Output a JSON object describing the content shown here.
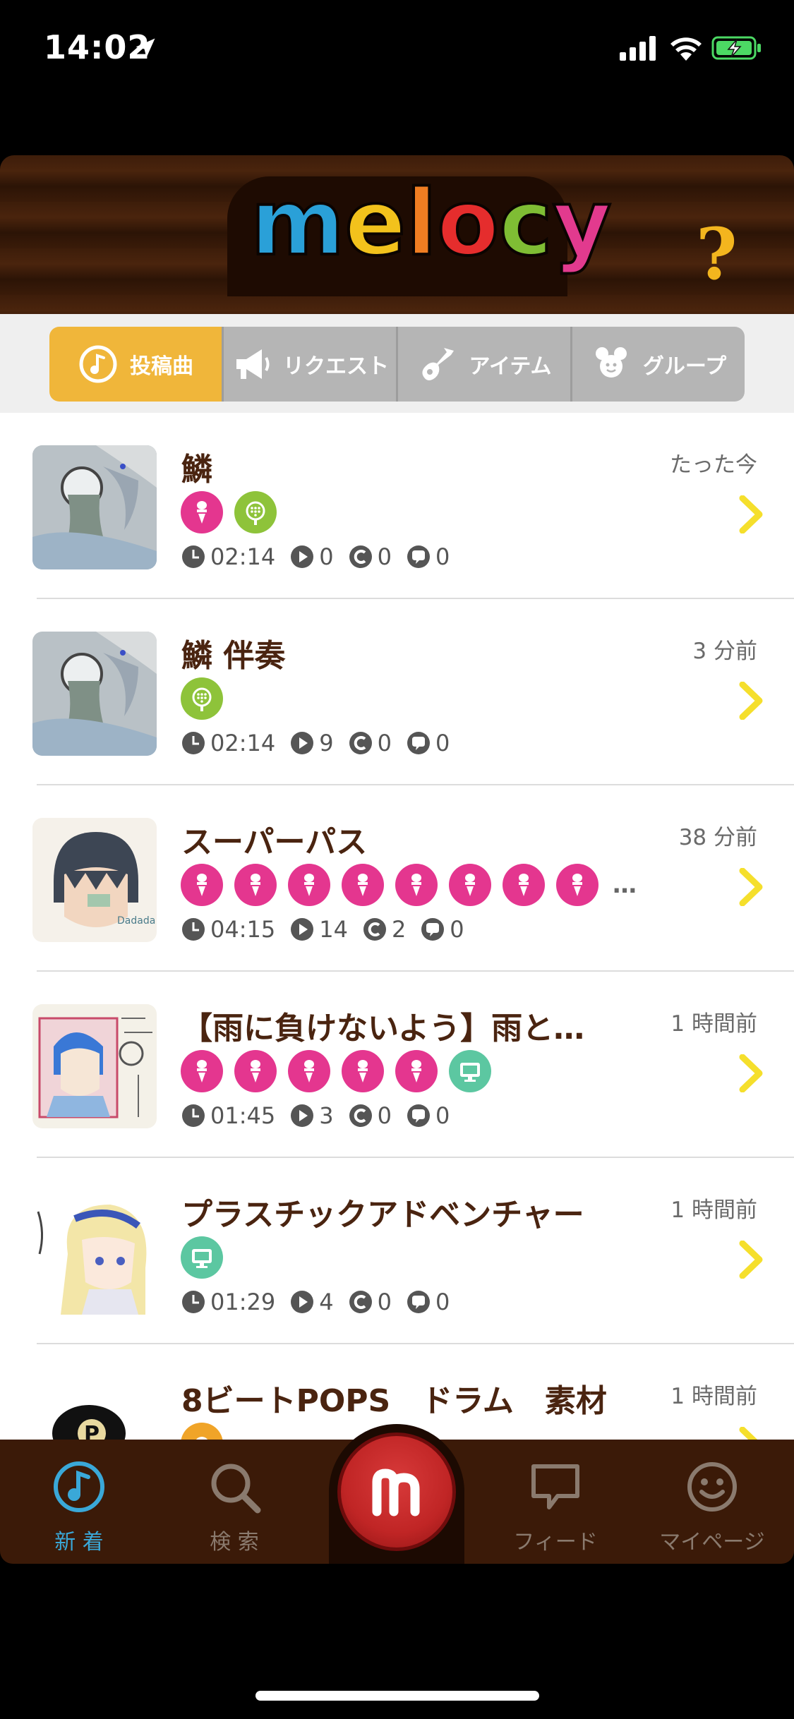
{
  "status_bar": {
    "time": "14:02"
  },
  "header": {
    "logo_letters": [
      {
        "ch": "m",
        "color": "#2aa0d8"
      },
      {
        "ch": "e",
        "color": "#f2c21c"
      },
      {
        "ch": "l",
        "color": "#ef7d22"
      },
      {
        "ch": "o",
        "color": "#e52d2d"
      },
      {
        "ch": "c",
        "color": "#7fbd34"
      },
      {
        "ch": "y",
        "color": "#e23a8e"
      }
    ],
    "help_label": "?"
  },
  "tabs": [
    {
      "label": "投稿曲",
      "icon": "music-note-icon",
      "active": true
    },
    {
      "label": "リクエスト",
      "icon": "megaphone-icon",
      "active": false
    },
    {
      "label": "アイテム",
      "icon": "guitar-icon",
      "active": false
    },
    {
      "label": "グループ",
      "icon": "group-icon",
      "active": false
    }
  ],
  "songs": [
    {
      "title": "鱗",
      "time": "たった今",
      "badges": [
        "vocal",
        "instrumental"
      ],
      "more": "",
      "duration": "02:14",
      "plays": "0",
      "comments": "0",
      "messages": "0"
    },
    {
      "title": "鱗 伴奏",
      "time": "3 分前",
      "badges": [
        "instrumental"
      ],
      "more": "",
      "duration": "02:14",
      "plays": "9",
      "comments": "0",
      "messages": "0"
    },
    {
      "title": "スーパーパス",
      "time": "38 分前",
      "badges": [
        "vocal",
        "vocal",
        "vocal",
        "vocal",
        "vocal",
        "vocal",
        "vocal",
        "vocal"
      ],
      "more": "…",
      "duration": "04:15",
      "plays": "14",
      "comments": "2",
      "messages": "0"
    },
    {
      "title": "【雨に負けないよう】雨と…",
      "time": "1 時間前",
      "badges": [
        "vocal",
        "vocal",
        "vocal",
        "vocal",
        "vocal",
        "video"
      ],
      "more": "",
      "duration": "01:45",
      "plays": "3",
      "comments": "0",
      "messages": "0"
    },
    {
      "title": "プラスチックアドベンチャー",
      "time": "1 時間前",
      "badges": [
        "video"
      ],
      "more": "",
      "duration": "01:29",
      "plays": "4",
      "comments": "0",
      "messages": "0"
    },
    {
      "title": "8ビートPOPS　ドラム　素材",
      "time": "1 時間前",
      "badges": [
        "orange"
      ],
      "more": "",
      "duration": "",
      "plays": "",
      "comments": "",
      "messages": ""
    }
  ],
  "thumb_labels": {
    "row3": "Dadada",
    "row6": "P"
  },
  "tabbar": [
    {
      "label": "新 着",
      "icon": "music-note-icon",
      "active": true
    },
    {
      "label": "検 索",
      "icon": "search-icon",
      "active": false
    },
    {
      "label": "",
      "icon": "melocy-record-icon",
      "active": false
    },
    {
      "label": "フィード",
      "icon": "speech-bubble-icon",
      "active": false
    },
    {
      "label": "マイページ",
      "icon": "smiley-icon",
      "active": false
    }
  ],
  "colors": {
    "accent": "#f0b63a",
    "header_brown": "#3d1d0a",
    "title_brown": "#4a2410",
    "chevron_yellow": "#f5df2c",
    "vocal_pink": "#e4368f",
    "instrumental_green": "#8ec33a",
    "video_teal": "#5cc7a1",
    "active_blue": "#3aa8d8"
  }
}
